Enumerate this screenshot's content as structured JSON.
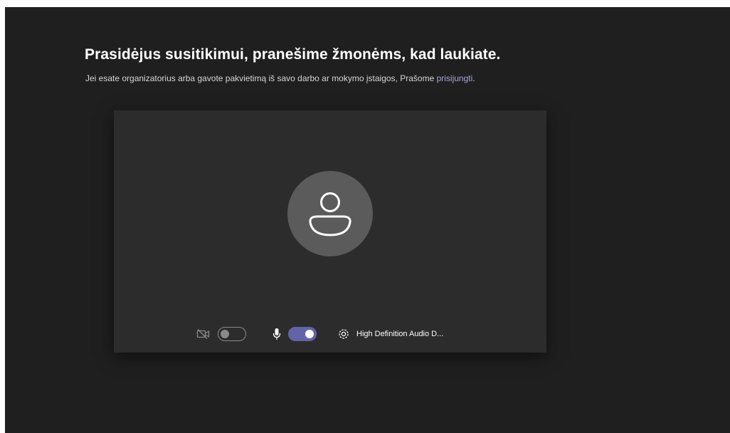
{
  "prejoin": {
    "title": "Prasidėjus susitikimui, pranešime žmonėms, kad laukiate.",
    "subtitle_prefix": "Jei esate organizatorius arba gavote pakvietimą iš savo darbo ar mokymo įstaigos, Prašome ",
    "signin_link": "prisijungti",
    "subtitle_suffix": "."
  },
  "preview": {
    "avatar_icon": "person-icon",
    "camera": {
      "icon": "camera-off-icon",
      "enabled": false
    },
    "microphone": {
      "icon": "microphone-icon",
      "enabled": true
    },
    "device_settings": {
      "icon": "gear-icon",
      "label": "High Definition Audio D..."
    }
  },
  "colors": {
    "background": "#1f1f1f",
    "panel": "#2d2c2c",
    "accent": "#6264a7",
    "link": "#a6a7dc",
    "avatar": "#5b5b5b"
  }
}
